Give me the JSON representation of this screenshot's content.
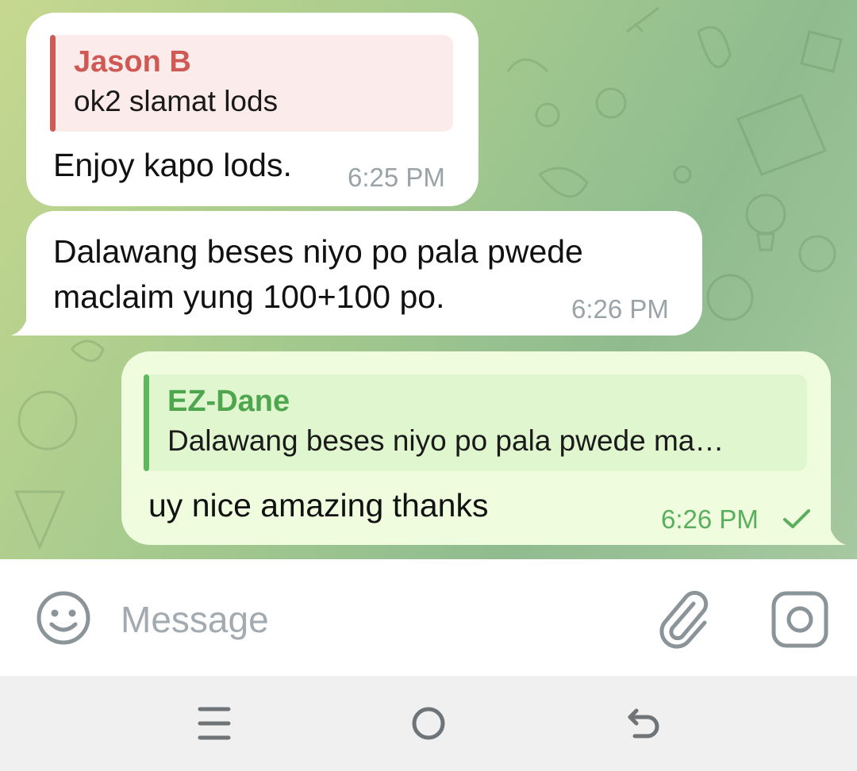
{
  "messages": [
    {
      "direction": "incoming",
      "reply_to": {
        "name": "Jason B",
        "text": "ok2 slamat lods"
      },
      "text": "Enjoy kapo lods.",
      "time": "6:25 PM"
    },
    {
      "direction": "incoming",
      "text": "Dalawang beses niyo po pala pwede\nmaclaim yung 100+100 po.",
      "time": "6:26 PM"
    },
    {
      "direction": "outgoing",
      "reply_to": {
        "name": "EZ-Dane",
        "text": "Dalawang beses niyo po pala pwede ma…"
      },
      "text": "uy nice amazing thanks",
      "time": "6:26 PM",
      "status": "sent-check-icon"
    }
  ],
  "composer": {
    "placeholder": "Message",
    "emoji_icon": "emoji-icon",
    "attach_icon": "paperclip-icon",
    "camera_icon": "camera-icon"
  },
  "navigation": {
    "icons": [
      "menu-icon",
      "home-icon",
      "back-icon"
    ]
  },
  "colors": {
    "incoming_bubble": "#ffffff",
    "outgoing_bubble": "#effdde",
    "incoming_reply_accent": "#cf5a55",
    "outgoing_reply_accent": "#5fb760",
    "outgoing_time": "#5aae5e"
  }
}
